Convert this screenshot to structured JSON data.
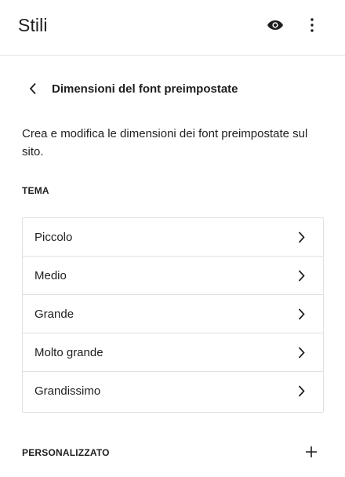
{
  "header": {
    "title": "Stili",
    "icons": {
      "preview": "eye-icon",
      "options": "more-vertical-icon"
    }
  },
  "nav": {
    "title": "Dimensioni del font preimpostate",
    "back_icon": "chevron-left-icon"
  },
  "description": "Crea e modifica le dimensioni dei font preimpostate sul sito.",
  "theme": {
    "label": "TEMA",
    "items": [
      {
        "label": "Piccolo"
      },
      {
        "label": "Medio"
      },
      {
        "label": "Grande"
      },
      {
        "label": "Molto grande"
      },
      {
        "label": "Grandissimo"
      }
    ]
  },
  "custom": {
    "label": "PERSONALIZZATO",
    "add_icon": "plus-icon"
  },
  "colors": {
    "text": "#1e1e1e",
    "border": "#e0e0e0",
    "background": "#ffffff"
  }
}
